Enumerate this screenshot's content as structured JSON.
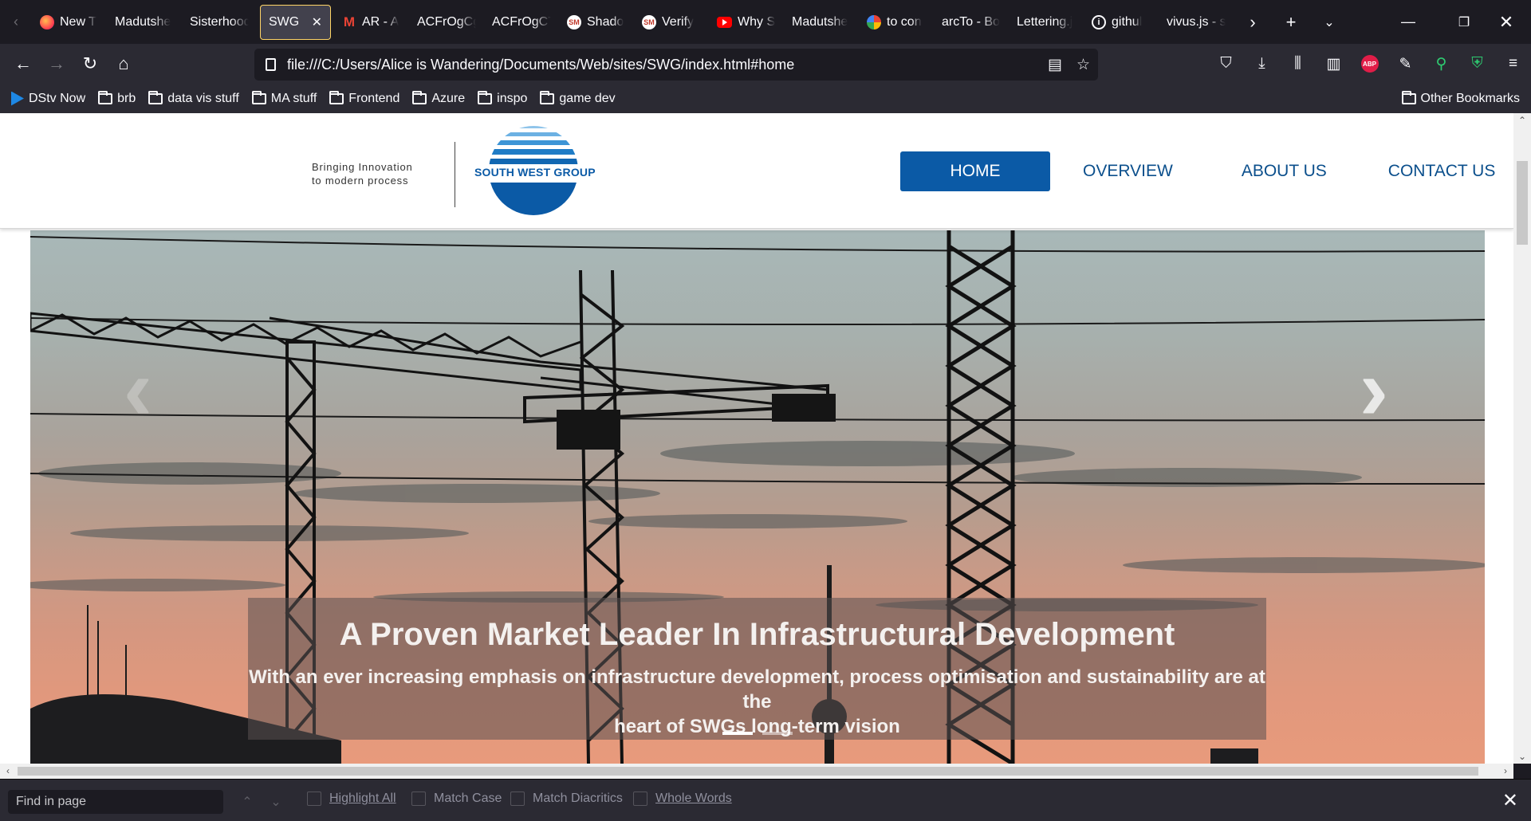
{
  "browser": {
    "tabs": [
      {
        "label": "New T",
        "icon": "firefox"
      },
      {
        "label": "Madutshe",
        "icon": ""
      },
      {
        "label": "Sisterhood",
        "icon": ""
      },
      {
        "label": "SWG",
        "icon": "",
        "active": true
      },
      {
        "label": "AR - A",
        "icon": "gmail"
      },
      {
        "label": "ACFrOgCg",
        "icon": ""
      },
      {
        "label": "ACFrOgCT",
        "icon": ""
      },
      {
        "label": "Shado",
        "icon": "sm"
      },
      {
        "label": "Verify",
        "icon": "sm"
      },
      {
        "label": "Why S",
        "icon": "youtube"
      },
      {
        "label": "Madutshe",
        "icon": ""
      },
      {
        "label": "to con",
        "icon": "google"
      },
      {
        "label": "arcTo - Bo",
        "icon": ""
      },
      {
        "label": "Lettering.j",
        "icon": ""
      },
      {
        "label": "githul",
        "icon": "info"
      },
      {
        "label": "vivus.js - s",
        "icon": ""
      }
    ],
    "url": "file:///C:/Users/Alice is Wandering/Documents/Web/sites/SWG/index.html#home",
    "bookmarks": [
      "DStv Now",
      "brb",
      "data vis stuff",
      "MA stuff",
      "Frontend",
      "Azure",
      "inspo",
      "game dev"
    ],
    "other_bookmarks": "Other Bookmarks"
  },
  "site": {
    "tagline_line1": "Bringing Innovation",
    "tagline_line2": "to modern process",
    "logo_text": "SOUTH WEST GROUP",
    "brand_color": "#0b5aa6",
    "nav": {
      "home": "HOME",
      "overview": "OVERVIEW",
      "about": "ABOUT US",
      "contact": "CONTACT US"
    },
    "hero": {
      "title": "A Proven Market Leader In Infrastructural Development",
      "text_line1": "With an ever increasing emphasis on infrastructure development, process optimisation and sustainability are at the",
      "text_line2": "heart of SWGs long-term vision",
      "slide_count": 2,
      "active_slide": 1
    }
  },
  "findbar": {
    "placeholder": "Find in page",
    "options": {
      "highlight_all": "Highlight All",
      "match_case": "Match Case",
      "match_diacritics": "Match Diacritics",
      "whole_words": "Whole Words"
    }
  }
}
